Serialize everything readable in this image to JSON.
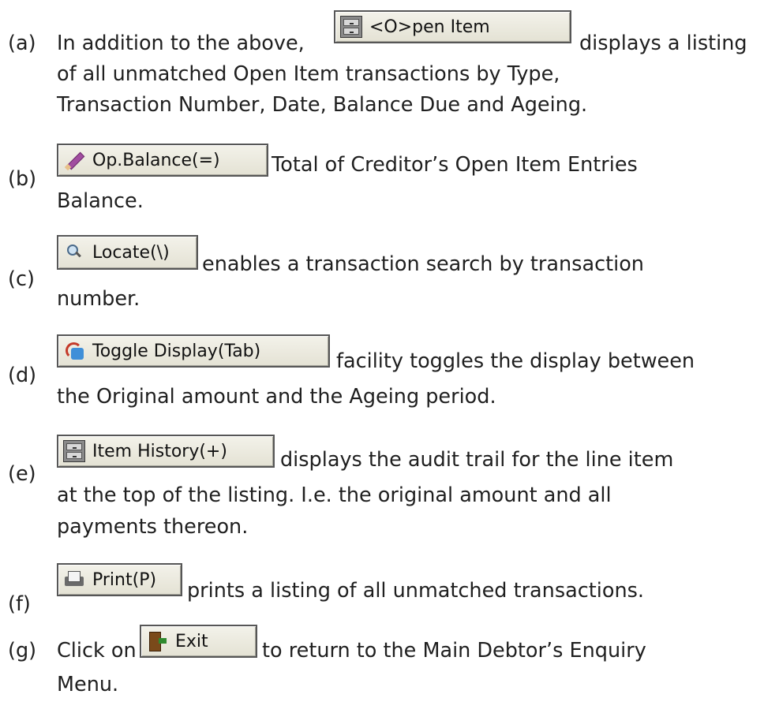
{
  "items": [
    {
      "letter": "(a)",
      "before": "In addition to the above,",
      "button": "<O>pen Item",
      "after": "displays a listing",
      "lines": [
        "of all unmatched Open Item transactions by Type,",
        "Transaction Number, Date, Balance Due and Ageing."
      ],
      "icon": "cabinet-icon"
    },
    {
      "letter": "(b)",
      "button": "Op.Balance(=)",
      "after": "Total of Creditor’s Open Item Entries",
      "lines": [
        "Balance."
      ],
      "icon": "pen-icon"
    },
    {
      "letter": "(c)",
      "button": "Locate(\\)",
      "after": "enables a transaction search by transaction",
      "lines": [
        "number."
      ],
      "icon": "magnifier-icon"
    },
    {
      "letter": "(d)",
      "button": "Toggle Display(Tab)",
      "after": "facility toggles the display between",
      "lines": [
        "the Original amount and the Ageing period."
      ],
      "icon": "toggle-icon"
    },
    {
      "letter": "(e)",
      "button": "Item History(+)",
      "after": "displays the audit trail for the line item",
      "lines": [
        "at the top of the listing. I.e. the original amount and all",
        "payments thereon."
      ],
      "icon": "cabinet-icon"
    },
    {
      "letter": "(f)",
      "button": "Print(P)",
      "after": "prints a listing of all unmatched transactions.",
      "lines": [],
      "icon": "printer-icon"
    },
    {
      "letter": "(g)",
      "before": "Click on",
      "button": "Exit",
      "after": "to return to the Main Debtor’s Enquiry",
      "lines": [
        "Menu."
      ],
      "icon": "exit-door-icon"
    }
  ]
}
